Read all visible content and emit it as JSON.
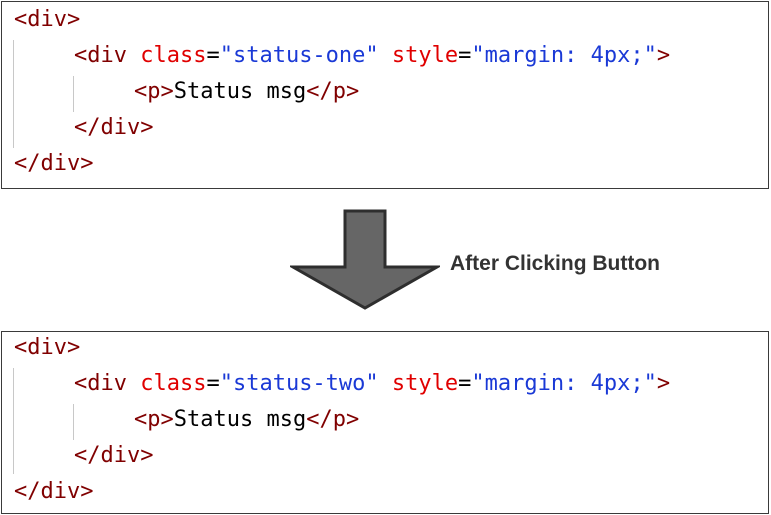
{
  "before": {
    "lines": [
      {
        "tokens": [
          {
            "t": "<div>",
            "c": "tag"
          }
        ]
      },
      {
        "tokens": [
          {
            "t": "<div ",
            "c": "tag"
          },
          {
            "t": "class",
            "c": "attr"
          },
          {
            "t": "=",
            "c": "eq"
          },
          {
            "t": "\"status-one\"",
            "c": "val"
          },
          {
            "t": " ",
            "c": "txt"
          },
          {
            "t": "style",
            "c": "attr"
          },
          {
            "t": "=",
            "c": "eq"
          },
          {
            "t": "\"margin: 4px;\"",
            "c": "val"
          },
          {
            "t": ">",
            "c": "tag"
          }
        ]
      },
      {
        "tokens": [
          {
            "t": "<p>",
            "c": "tag"
          },
          {
            "t": "Status msg",
            "c": "txt"
          },
          {
            "t": "</p>",
            "c": "tag"
          }
        ]
      },
      {
        "tokens": [
          {
            "t": "</div>",
            "c": "tag"
          }
        ]
      },
      {
        "tokens": [
          {
            "t": "</div>",
            "c": "tag"
          }
        ]
      }
    ]
  },
  "transition": {
    "label": "After Clicking Button",
    "arrow_icon": "down-arrow-icon",
    "arrow_fill": "#666666",
    "arrow_stroke": "#2e2e2e"
  },
  "after": {
    "lines": [
      {
        "tokens": [
          {
            "t": "<div>",
            "c": "tag"
          }
        ]
      },
      {
        "tokens": [
          {
            "t": "<div ",
            "c": "tag"
          },
          {
            "t": "class",
            "c": "attr"
          },
          {
            "t": "=",
            "c": "eq"
          },
          {
            "t": "\"status-two\"",
            "c": "val"
          },
          {
            "t": " ",
            "c": "txt"
          },
          {
            "t": "style",
            "c": "attr"
          },
          {
            "t": "=",
            "c": "eq"
          },
          {
            "t": "\"margin: 4px;\"",
            "c": "val"
          },
          {
            "t": ">",
            "c": "tag"
          }
        ]
      },
      {
        "tokens": [
          {
            "t": "<p>",
            "c": "tag"
          },
          {
            "t": "Status msg",
            "c": "txt"
          },
          {
            "t": "</p>",
            "c": "tag"
          }
        ]
      },
      {
        "tokens": [
          {
            "t": "</div>",
            "c": "tag"
          }
        ]
      },
      {
        "tokens": [
          {
            "t": "</div>",
            "c": "tag"
          }
        ]
      }
    ]
  },
  "colors": {
    "tag": "#800000",
    "attribute": "#e00000",
    "value": "#1a39d6",
    "text": "#000000"
  }
}
